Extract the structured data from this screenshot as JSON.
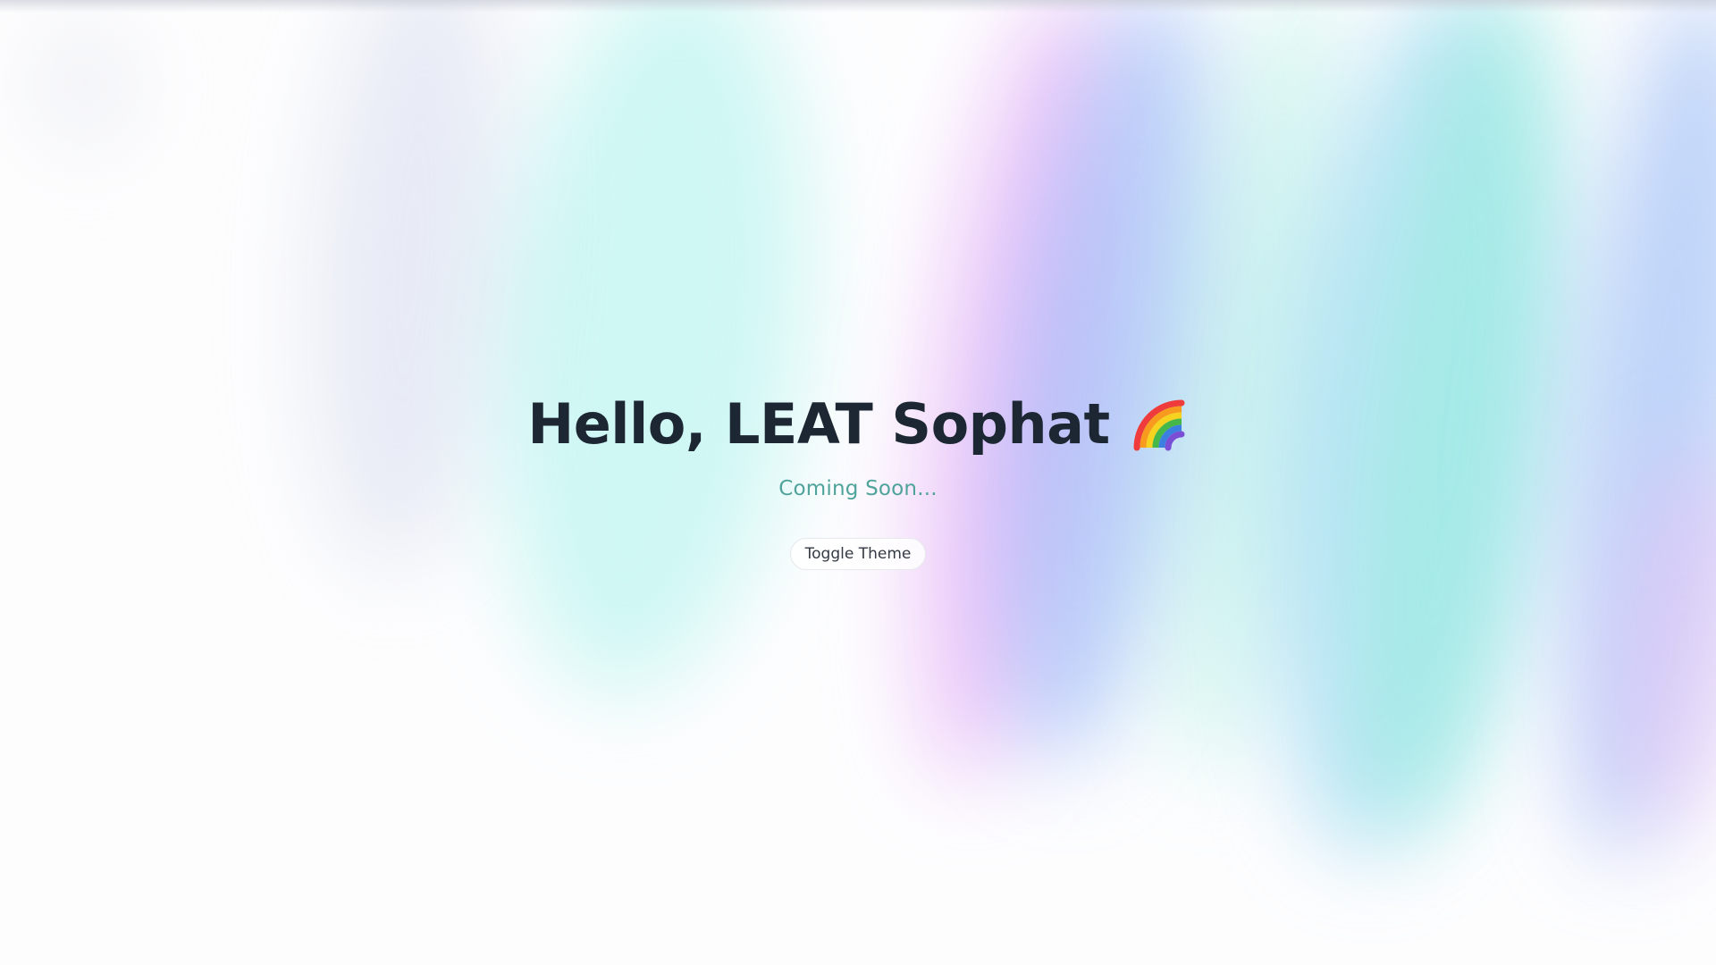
{
  "hero": {
    "greeting": "Hello, LEAT Sophat",
    "emoji_icon": "rainbow-icon",
    "subtitle": "Coming Soon...",
    "toggle_button_label": "Toggle Theme"
  },
  "colors": {
    "title": "#1c2733",
    "subtitle": "#4fa39b",
    "button_border": "#e6e8ec",
    "aurora": [
      "#7ff0e6",
      "#e9a6f7",
      "#8fb8f5",
      "#86e8cf",
      "#a9c6f7",
      "#f3c2f4"
    ]
  }
}
